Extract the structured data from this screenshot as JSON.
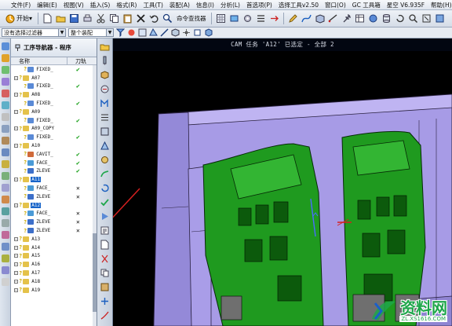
{
  "menu": {
    "items": [
      "文件(F)",
      "编辑(E)",
      "视图(V)",
      "插入(S)",
      "格式(R)",
      "工具(T)",
      "装配(A)",
      "信息(I)",
      "分析(L)",
      "首选项(P)",
      "选择工具v2.50",
      "窗口(O)",
      "GC 工具箱",
      "星空 V6.935F",
      "帮助(H)"
    ]
  },
  "toolbar": {
    "start_label": "开始▾",
    "command_finder_label": "命令查找器"
  },
  "filterbar": {
    "filter_value": "没有选择过滤器",
    "assembly_value": "整个装配"
  },
  "navigator": {
    "title": "工序导航器 - 程序",
    "col_name": "名称",
    "col_toolpath": "刀轨",
    "rows": [
      {
        "indent": 2,
        "icon": "mill",
        "label": "FIXED_",
        "status": "✔",
        "kind": "ok"
      },
      {
        "indent": 0,
        "icon": "group",
        "label": "A07",
        "status": "",
        "kind": ""
      },
      {
        "indent": 2,
        "icon": "mill",
        "label": "FIXED_",
        "status": "✔",
        "kind": "ok"
      },
      {
        "indent": 0,
        "icon": "group",
        "label": "A08",
        "status": "",
        "kind": ""
      },
      {
        "indent": 2,
        "icon": "mill",
        "label": "FIXED_",
        "status": "✔",
        "kind": "ok"
      },
      {
        "indent": 0,
        "icon": "group",
        "label": "A09",
        "status": "",
        "kind": ""
      },
      {
        "indent": 2,
        "icon": "mill",
        "label": "FIXED_",
        "status": "✔",
        "kind": "ok"
      },
      {
        "indent": 0,
        "icon": "group",
        "label": "A09_COPY",
        "status": "",
        "kind": ""
      },
      {
        "indent": 2,
        "icon": "mill",
        "label": "FIXED_",
        "status": "✔",
        "kind": "ok"
      },
      {
        "indent": 0,
        "icon": "group",
        "label": "A10",
        "status": "",
        "kind": ""
      },
      {
        "indent": 2,
        "icon": "cavity",
        "label": "CAVIT_",
        "status": "✔",
        "kind": "ok"
      },
      {
        "indent": 2,
        "icon": "face",
        "label": "FACE_",
        "status": "✔",
        "kind": "ok"
      },
      {
        "indent": 2,
        "icon": "zlevel",
        "label": "ZLEVE",
        "status": "✔",
        "kind": "ok"
      },
      {
        "indent": 0,
        "icon": "group",
        "label": "A11",
        "status": "",
        "kind": "",
        "selected": true
      },
      {
        "indent": 2,
        "icon": "face",
        "label": "FACE_",
        "status": "✕",
        "kind": "no"
      },
      {
        "indent": 2,
        "icon": "zlevel",
        "label": "ZLEVE",
        "status": "✕",
        "kind": "no"
      },
      {
        "indent": 0,
        "icon": "group",
        "label": "A12",
        "status": "",
        "kind": "",
        "selected": true
      },
      {
        "indent": 2,
        "icon": "face",
        "label": "FACE_",
        "status": "✕",
        "kind": "no"
      },
      {
        "indent": 2,
        "icon": "zlevel",
        "label": "ZLEVE",
        "status": "✕",
        "kind": "no"
      },
      {
        "indent": 2,
        "icon": "zlevel",
        "label": "ZLEVE",
        "status": "✕",
        "kind": "no"
      },
      {
        "indent": 0,
        "icon": "group",
        "label": "A13",
        "status": "",
        "kind": ""
      },
      {
        "indent": 0,
        "icon": "group",
        "label": "A14",
        "status": "",
        "kind": ""
      },
      {
        "indent": 0,
        "icon": "group",
        "label": "A15",
        "status": "",
        "kind": ""
      },
      {
        "indent": 0,
        "icon": "group",
        "label": "A16",
        "status": "",
        "kind": ""
      },
      {
        "indent": 0,
        "icon": "group",
        "label": "A17",
        "status": "",
        "kind": ""
      },
      {
        "indent": 0,
        "icon": "group",
        "label": "A18",
        "status": "",
        "kind": ""
      },
      {
        "indent": 0,
        "icon": "group",
        "label": "A19",
        "status": "",
        "kind": ""
      }
    ]
  },
  "graphics": {
    "title": "CAM 任务 'A12' 已选定 - 全部 2"
  },
  "watermark": {
    "main": "资料网",
    "sub": "ZL.XS1616.COM"
  },
  "colors": {
    "part_green": "#1f9a1f",
    "mold_lavender": "#a79be6",
    "selection_blue": "#1764c9",
    "arrow_red": "#d62020"
  }
}
